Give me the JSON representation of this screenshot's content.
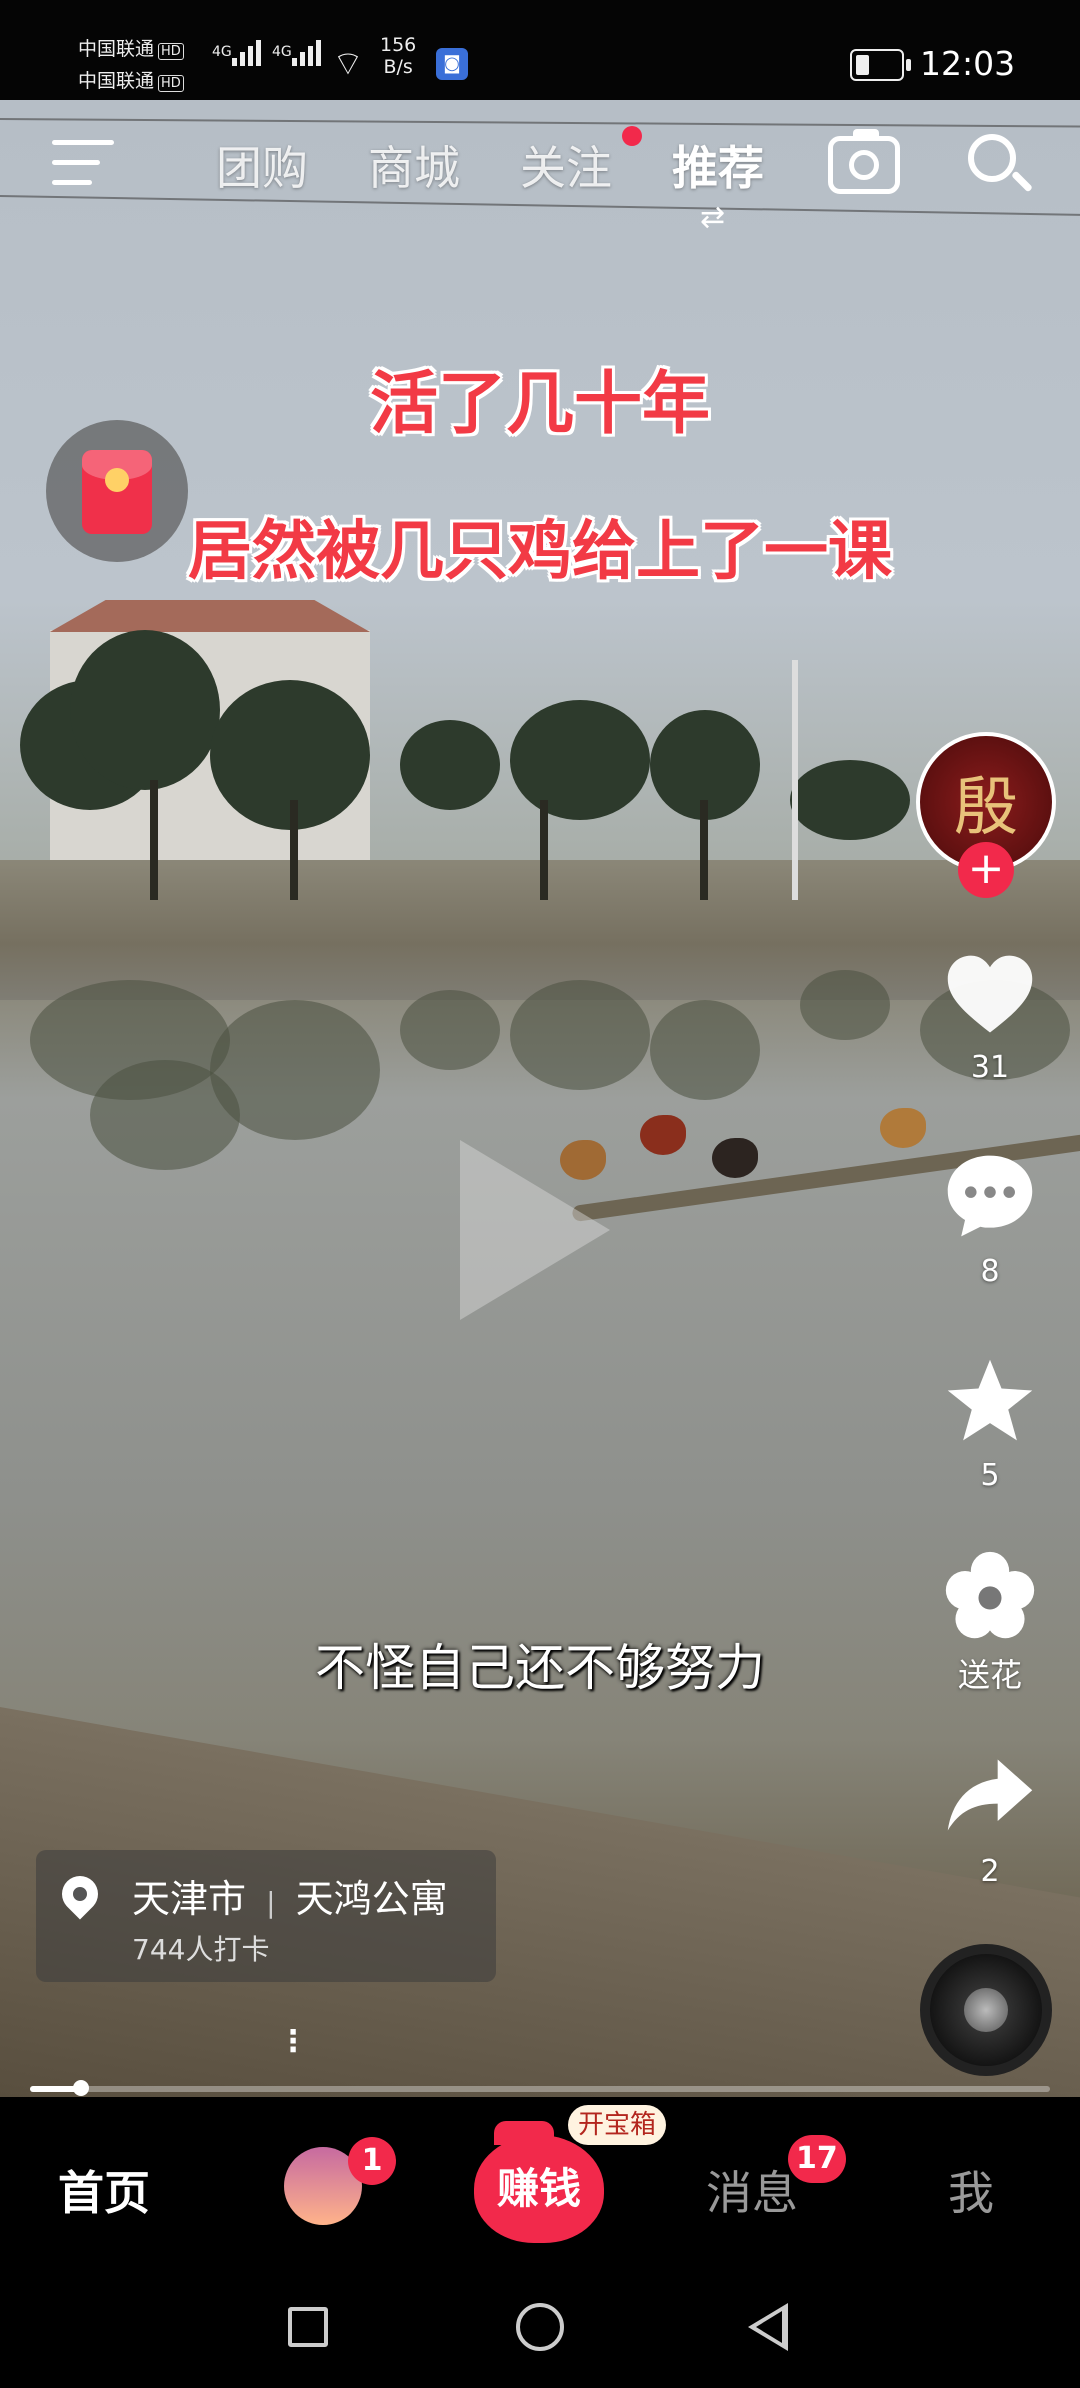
{
  "status_bar": {
    "carrier1": "中国联通",
    "carrier2": "中国联通",
    "hd_label": "HD",
    "network1": "4G",
    "network2": "4G",
    "speed_value": "156",
    "speed_unit": "B/s",
    "battery_level": 0.35,
    "time": "12:03"
  },
  "top_nav": {
    "tabs": [
      {
        "label": "团购"
      },
      {
        "label": "商城"
      },
      {
        "label": "关注"
      },
      {
        "label": "推荐"
      }
    ],
    "active_tab": "推荐",
    "swap_icon": "⇄",
    "icons": [
      "menu-icon",
      "camera-icon",
      "search-icon"
    ]
  },
  "video": {
    "title_line1": "活了几十年",
    "title_line2": "居然被几只鸡给上了一课",
    "subtitle": "不怪自己还不够努力",
    "progress": 0.05
  },
  "author": {
    "avatar_text": "殷",
    "follow_symbol": "+"
  },
  "actions": {
    "likes": "31",
    "comments": "8",
    "favorites": "5",
    "flower_label": "送花",
    "shares": "2"
  },
  "location": {
    "city": "天津市",
    "separator": "|",
    "place": "天鸿公寓",
    "checkins": "744人打卡"
  },
  "more_symbol": "⋮",
  "bottom_nav": {
    "home": "首页",
    "friends_badge": "1",
    "earn": "赚钱",
    "earn_tag": "开宝箱",
    "messages": "消息",
    "messages_badge": "17",
    "me": "我"
  },
  "colors": {
    "accent": "#f2294b",
    "title_red": "#f23a45"
  }
}
